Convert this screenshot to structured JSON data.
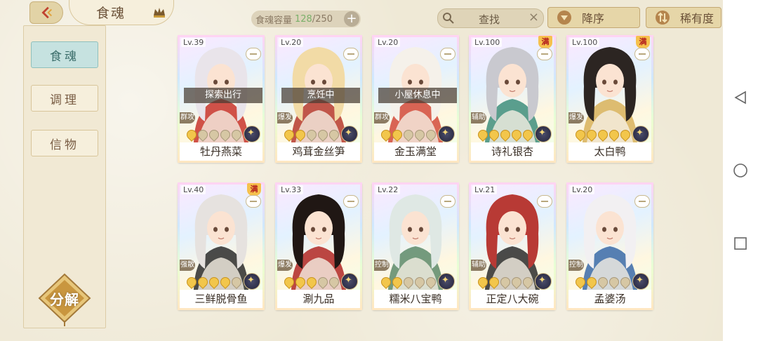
{
  "header": {
    "title": "食魂",
    "capacity_label": "食魂容量",
    "capacity_current": "128",
    "capacity_total": "/250",
    "add_label": "+",
    "search_placeholder": "查找",
    "search_clear": "×",
    "sort_order_label": "降序",
    "sort_key_label": "稀有度"
  },
  "sidebar": {
    "items": [
      {
        "label": "食魂",
        "active": true
      },
      {
        "label": "调理",
        "active": false
      },
      {
        "label": "信物",
        "active": false
      }
    ],
    "decompose_label": "分解"
  },
  "cards": [
    {
      "level": "Lv.39",
      "name": "牡丹燕菜",
      "status": "探索出行",
      "role": "群攻",
      "stars": 5,
      "lit": 1,
      "max": false,
      "hair": "#e9e4ea",
      "accent": "#c8342b"
    },
    {
      "level": "Lv.20",
      "name": "鸡茸金丝笋",
      "status": "烹饪中",
      "role": "爆发",
      "stars": 5,
      "lit": 2,
      "max": false,
      "hair": "#f2dba6",
      "accent": "#b6392e"
    },
    {
      "level": "Lv.20",
      "name": "金玉满堂",
      "status": "小屋休息中",
      "role": "群攻",
      "stars": 5,
      "lit": 2,
      "max": false,
      "hair": "#f5f1ea",
      "accent": "#d24a3a"
    },
    {
      "level": "Lv.100",
      "name": "诗礼银杏",
      "status": "",
      "role": "辅助",
      "stars": 5,
      "lit": 5,
      "max": true,
      "hair": "#c9c9cf",
      "accent": "#3e8e7c"
    },
    {
      "level": "Lv.100",
      "name": "太白鸭",
      "status": "",
      "role": "爆发",
      "stars": 5,
      "lit": 5,
      "max": true,
      "hair": "#2c2522",
      "accent": "#d8b15a"
    },
    {
      "level": "Lv.40",
      "name": "三鲜脱骨鱼",
      "status": "",
      "role": "强散",
      "stars": 5,
      "lit": 4,
      "max": true,
      "hair": "#e6e2df",
      "accent": "#2b2b2b"
    },
    {
      "level": "Lv.33",
      "name": "涮九品",
      "status": "",
      "role": "爆发",
      "stars": 5,
      "lit": 3,
      "max": false,
      "hair": "#201714",
      "accent": "#b02725"
    },
    {
      "level": "Lv.22",
      "name": "糯米八宝鸭",
      "status": "",
      "role": "控制",
      "stars": 5,
      "lit": 2,
      "max": false,
      "hair": "#dfe8e4",
      "accent": "#5d8a6a"
    },
    {
      "level": "Lv.21",
      "name": "正定八大碗",
      "status": "",
      "role": "辅助",
      "stars": 5,
      "lit": 2,
      "max": false,
      "hair": "#b83a35",
      "accent": "#2b2b2b"
    },
    {
      "level": "Lv.20",
      "name": "孟婆汤",
      "status": "",
      "role": "控制",
      "stars": 5,
      "lit": 2,
      "max": false,
      "hair": "#f2f0f2",
      "accent": "#3a6aa8"
    }
  ]
}
